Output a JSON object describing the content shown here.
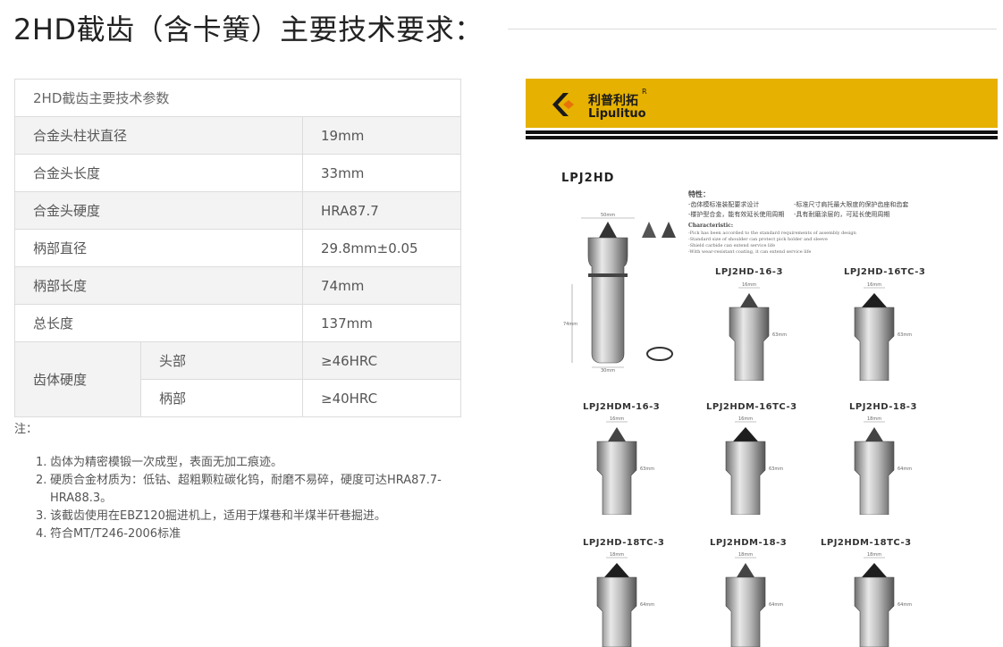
{
  "page": {
    "title": "2HD截齿（含卡簧）主要技术要求："
  },
  "spec_table": {
    "header": "2HD截齿主要技术参数",
    "rows": [
      {
        "label": "合金头柱状直径",
        "value": "19mm"
      },
      {
        "label": "合金头长度",
        "value": "33mm"
      },
      {
        "label": "合金头硬度",
        "value": "HRA87.7"
      },
      {
        "label": "柄部直径",
        "value": "29.8mm±0.05"
      },
      {
        "label": "柄部长度",
        "value": "74mm"
      },
      {
        "label": "总长度",
        "value": "137mm"
      }
    ],
    "hardness": {
      "label": "齿体硬度",
      "sub": [
        {
          "label": "头部",
          "value": "≥46HRC"
        },
        {
          "label": "柄部",
          "value": "≥40HRC"
        }
      ]
    }
  },
  "notes": {
    "label": "注：",
    "items": [
      {
        "num": "1.",
        "text": "齿体为精密模锻一次成型，表面无加工痕迹。"
      },
      {
        "num": "2.",
        "text": "硬质合金材质为：低钴、超粗颗粒碳化钨，耐磨不易碎，硬度可达HRA87.7-HRA88.3。"
      },
      {
        "num": "3.",
        "text": "该截齿使用在EBZ120掘进机上，适用于煤巷和半煤半矸巷掘进。"
      },
      {
        "num": "4.",
        "text": "符合MT/T246-2006标准"
      }
    ]
  },
  "product_image": {
    "brand_cn": "利普利拓",
    "brand_en": "Lipulituo",
    "brand_mark": "R",
    "model": "LPJ2HD",
    "features_cn_head": "特性：",
    "features_cn": [
      "-齿体模标准装配要求设计",
      "-楼护型合金，能有效延长使用周期",
      "-标准尺寸肩托最大限度的保护齿座和齿套",
      "-具有耐磨涂层的，可延长使用周期"
    ],
    "features_en_head": "Characteristic:",
    "features_en": [
      "-Pick has been accorded to the standard requirements of assembly design",
      "-Standard size of shoulder can protect pick holder and sleeve",
      "-Shield carbide can extend service life",
      "-With wear-resistant coating, it can extend service life"
    ],
    "main_dims": [
      "50mm",
      "74mm",
      "30mm"
    ],
    "variants": [
      {
        "label": "LPJ2HD-16-3",
        "top": "16mm",
        "side": "63mm"
      },
      {
        "label": "LPJ2HD-16TC-3",
        "top": "16mm",
        "side": "63mm"
      },
      {
        "label": "LPJ2HDM-16-3",
        "top": "16mm",
        "side": "63mm"
      },
      {
        "label": "LPJ2HDM-16TC-3",
        "top": "16mm",
        "side": "63mm"
      },
      {
        "label": "LPJ2HD-18-3",
        "top": "18mm",
        "side": "64mm"
      },
      {
        "label": "LPJ2HD-18TC-3",
        "top": "18mm",
        "side": "64mm"
      },
      {
        "label": "LPJ2HDM-18-3",
        "top": "18mm",
        "side": "64mm"
      },
      {
        "label": "LPJ2HDM-18TC-3",
        "top": "18mm",
        "side": "64mm"
      }
    ],
    "watermark": "Lipulituo"
  }
}
